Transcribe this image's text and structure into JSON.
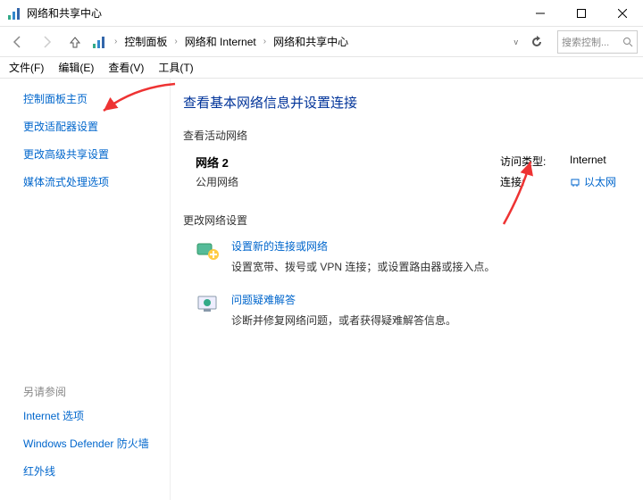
{
  "window": {
    "title": "网络和共享中心"
  },
  "breadcrumb": {
    "items": [
      "控制面板",
      "网络和 Internet",
      "网络和共享中心"
    ]
  },
  "search": {
    "placeholder": "搜索控制..."
  },
  "menubar": {
    "file": "文件(F)",
    "edit": "编辑(E)",
    "view": "查看(V)",
    "tools": "工具(T)"
  },
  "sidebar": {
    "home": "控制面板主页",
    "adapter": "更改适配器设置",
    "advanced": "更改高级共享设置",
    "media": "媒体流式处理选项",
    "see_also_hdr": "另请参阅",
    "internet_options": "Internet 选项",
    "defender": "Windows Defender 防火墙",
    "infrared": "红外线"
  },
  "main": {
    "heading": "查看基本网络信息并设置连接",
    "active_networks_label": "查看活动网络",
    "network": {
      "name": "网络 2",
      "type": "公用网络",
      "access_label": "访问类型:",
      "access_value": "Internet",
      "connection_label": "连接:",
      "connection_value": "以太网"
    },
    "change_settings_label": "更改网络设置",
    "task1": {
      "title": "设置新的连接或网络",
      "desc": "设置宽带、拨号或 VPN 连接；或设置路由器或接入点。"
    },
    "task2": {
      "title": "问题疑难解答",
      "desc": "诊断并修复网络问题，或者获得疑难解答信息。"
    }
  }
}
